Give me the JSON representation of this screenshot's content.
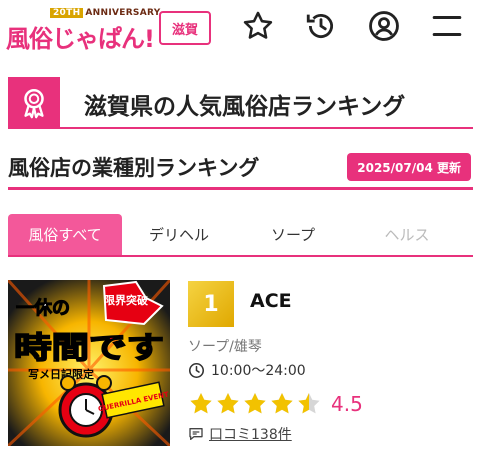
{
  "header": {
    "logo_anniversary_num": "20TH",
    "logo_anniversary": "ANNIVERSARY",
    "logo_name": "風俗じゃぱん!",
    "prefecture": "滋賀",
    "icons": [
      "star-icon",
      "history-icon",
      "account-icon",
      "menu-icon"
    ]
  },
  "banner": {
    "title": "滋賀県の人気風俗店ランキング",
    "icon": "award-ribbon-icon"
  },
  "section": {
    "title": "風俗店の業種別ランキング",
    "updated": "2025/07/04 更新"
  },
  "tabs": [
    {
      "label": "風俗すべて",
      "active": true
    },
    {
      "label": "デリヘル",
      "active": false
    },
    {
      "label": "ソープ",
      "active": false
    },
    {
      "label": "ヘルス",
      "active": false
    }
  ],
  "shop": {
    "rank": "1",
    "name": "ACE",
    "genre": "ソープ/雄琴",
    "hours": "10:00〜24:00",
    "rating": 4.5,
    "rating_text": "4.5",
    "reviews": "口コミ138件",
    "image": {
      "text_top": "一休の",
      "text_main": "時間です",
      "badge": "限界突破",
      "sub": "写メ日記限定",
      "event": "GUERRILLA EVENT"
    }
  },
  "colors": {
    "accent": "#e8317c",
    "star": "#f2c200",
    "rank_gold": "#e9b80a"
  }
}
